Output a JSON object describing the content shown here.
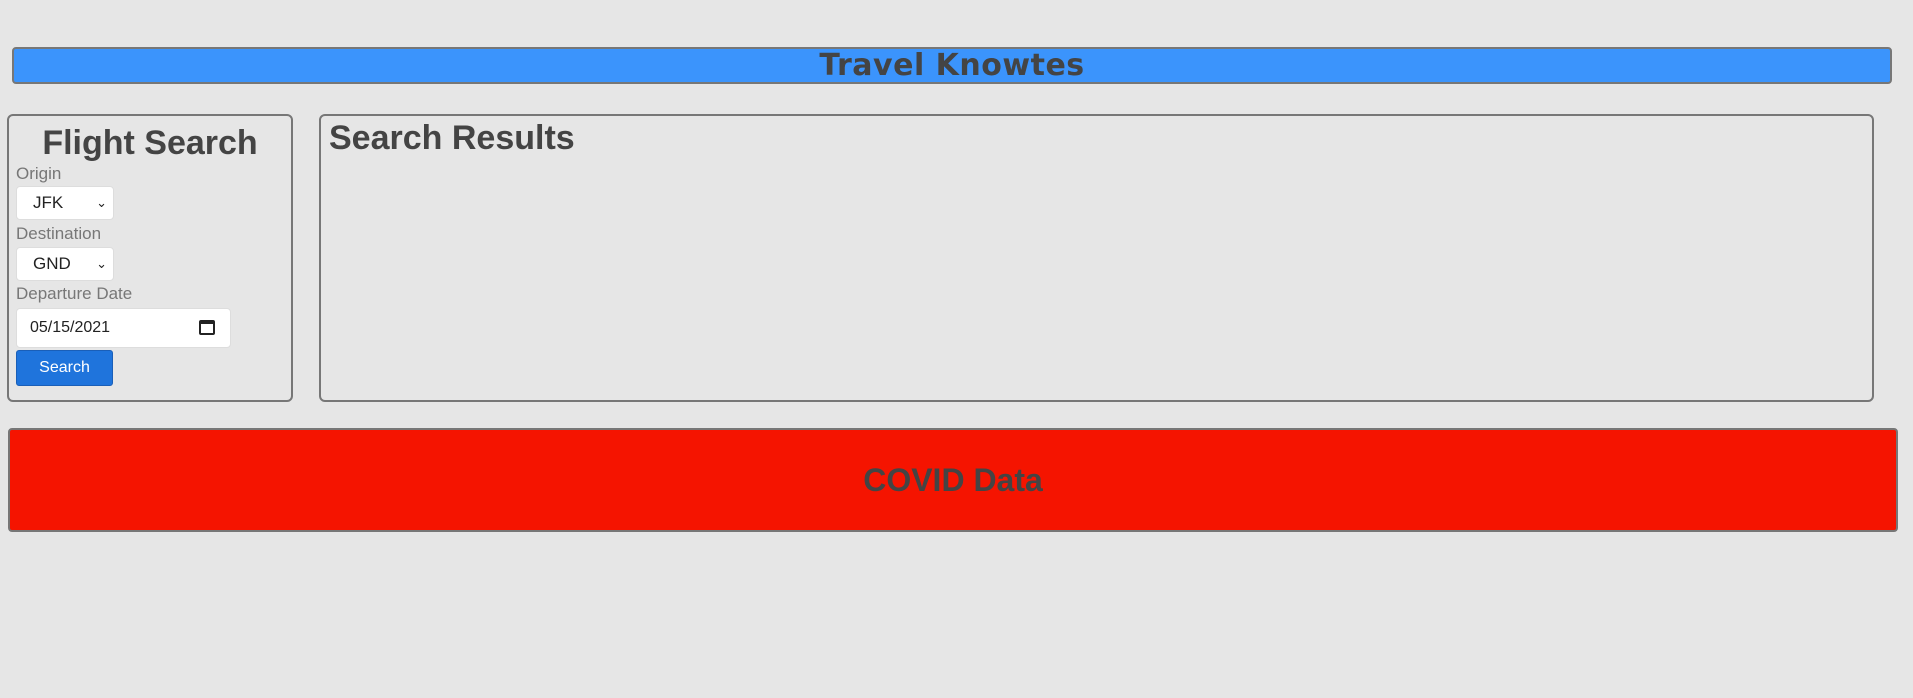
{
  "header": {
    "title": "Travel Knowtes"
  },
  "flight_search": {
    "title": "Flight Search",
    "origin_label": "Origin",
    "origin_value": "JFK",
    "destination_label": "Destination",
    "destination_value": "GND",
    "departure_label": "Departure Date",
    "departure_value": "05/15/2021",
    "search_button": "Search"
  },
  "results": {
    "title": "Search Results"
  },
  "covid": {
    "title": "COVID Data"
  },
  "colors": {
    "header_bg": "#3b94fc",
    "covid_bg": "#f51400",
    "button_bg": "#1f74dc",
    "page_bg": "#e6e6e6"
  }
}
